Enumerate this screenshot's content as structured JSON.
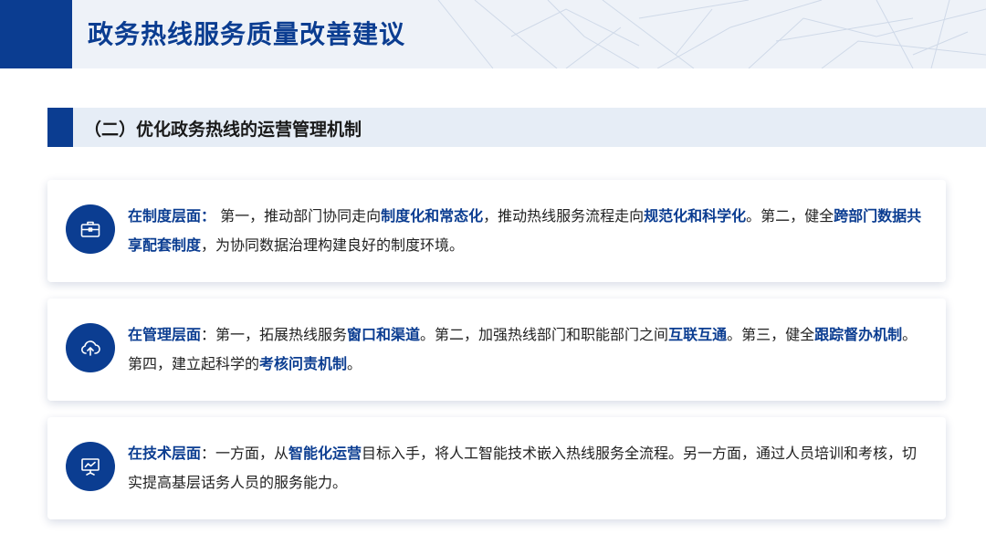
{
  "header": {
    "title": "政务热线服务质量改善建议"
  },
  "section": {
    "title": "（二）优化政务热线的运营管理机制"
  },
  "cards": [
    {
      "icon": "briefcase-icon",
      "segments": [
        {
          "text": "在制度层面：",
          "hl": true
        },
        {
          "text": " 第一，推动部门协同走向",
          "hl": false
        },
        {
          "text": "制度化和常态化",
          "hl": true
        },
        {
          "text": "，推动热线服务流程走向",
          "hl": false
        },
        {
          "text": "规范化和科学化",
          "hl": true
        },
        {
          "text": "。第二，健全",
          "hl": false
        },
        {
          "text": "跨部门数据共享配套制度",
          "hl": true
        },
        {
          "text": "，为协同数据治理构建良好的制度环境。",
          "hl": false
        }
      ]
    },
    {
      "icon": "cloud-upload-icon",
      "segments": [
        {
          "text": "在管理层面",
          "hl": true
        },
        {
          "text": "：第一，拓展热线服务",
          "hl": false
        },
        {
          "text": "窗口和渠道",
          "hl": true
        },
        {
          "text": "。第二，加强热线部门和职能部门之间",
          "hl": false
        },
        {
          "text": "互联互通",
          "hl": true
        },
        {
          "text": "。第三，健全",
          "hl": false
        },
        {
          "text": "跟踪督办机制",
          "hl": true
        },
        {
          "text": "。第四，建立起科学的",
          "hl": false
        },
        {
          "text": "考核问责机制",
          "hl": true
        },
        {
          "text": "。",
          "hl": false
        }
      ]
    },
    {
      "icon": "presentation-chart-icon",
      "segments": [
        {
          "text": "在技术层面",
          "hl": true
        },
        {
          "text": "：一方面，从",
          "hl": false
        },
        {
          "text": "智能化运营",
          "hl": true
        },
        {
          "text": "目标入手，将人工智能技术嵌入热线服务全流程。另一方面，通过人员培训和考核，切实提高基层话务人员的服务能力。",
          "hl": false
        }
      ]
    }
  ]
}
